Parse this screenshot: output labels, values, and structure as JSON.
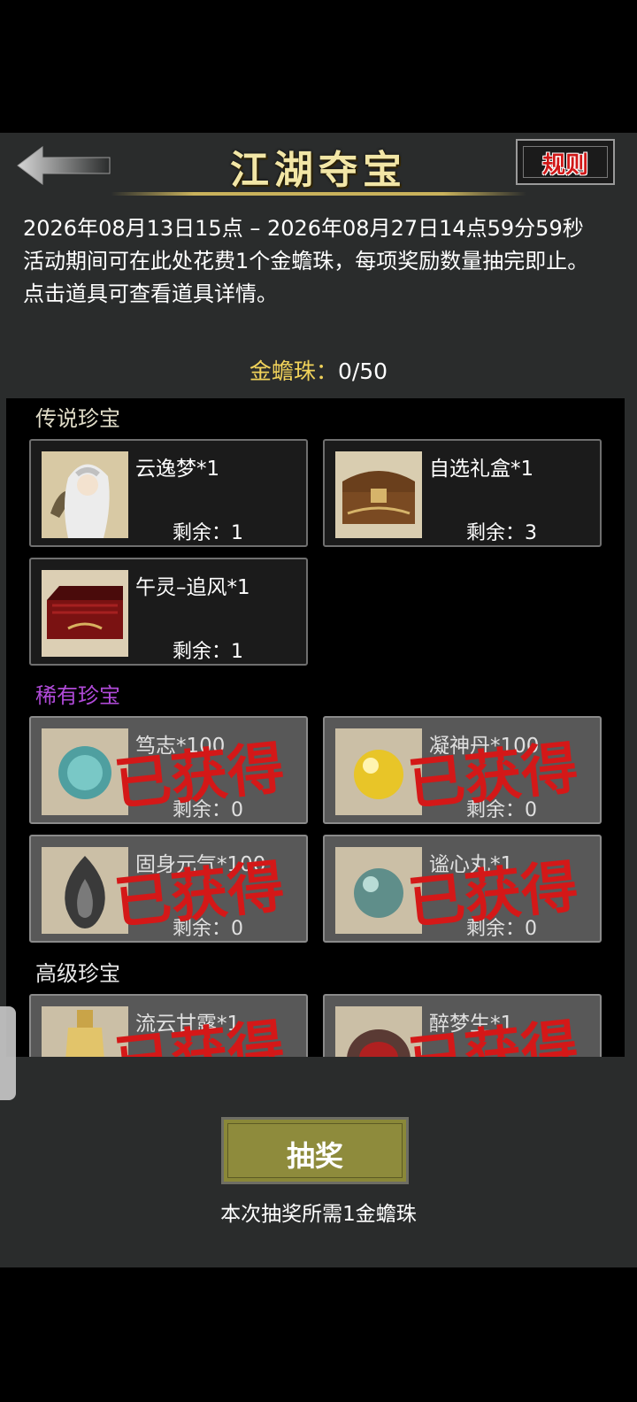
{
  "header": {
    "title": "江湖夺宝",
    "rules_label": "规则"
  },
  "info": {
    "period": "2026年08月13日15点 – 2026年08月27日14点59分59秒",
    "desc": "活动期间可在此处花费1个金蟾珠，每项奖励数量抽完即止。",
    "hint": "点击道具可查看道具详情。"
  },
  "currency": {
    "label": "金蟾珠：",
    "value": "0/50"
  },
  "sections": [
    {
      "title": "传说珍宝",
      "items": [
        {
          "name": "云逸梦*1",
          "remain": "剩余：1",
          "obtained": false,
          "icon": "portrait-woman-icon"
        },
        {
          "name": "自选礼盒*1",
          "remain": "剩余：3",
          "obtained": false,
          "icon": "treasure-chest-icon"
        },
        {
          "name": "午灵–追风*1",
          "remain": "剩余：1",
          "obtained": false,
          "icon": "red-box-icon"
        }
      ]
    },
    {
      "title": "稀有珍宝",
      "items": [
        {
          "name": "笃志*100",
          "remain": "剩余：0",
          "obtained": true,
          "icon": "blue-orb-icon"
        },
        {
          "name": "凝神丹*100",
          "remain": "剩余：0",
          "obtained": true,
          "icon": "yellow-pearl-icon"
        },
        {
          "name": "固身元气*100",
          "remain": "剩余：0",
          "obtained": true,
          "icon": "flame-icon"
        },
        {
          "name": "谧心丸*1",
          "remain": "剩余：0",
          "obtained": true,
          "icon": "teal-pearl-icon"
        }
      ]
    },
    {
      "title": "高级珍宝",
      "items": [
        {
          "name": "流云甘露*1",
          "remain": "",
          "obtained": true,
          "icon": "gourd-bottle-icon"
        },
        {
          "name": "醉梦生*1",
          "remain": "",
          "obtained": true,
          "icon": "wine-jar-icon"
        }
      ]
    }
  ],
  "obtained_stamp": "已获得",
  "draw": {
    "button_label": "抽奖",
    "note": "本次抽奖所需1金蟾珠"
  },
  "colors": {
    "panel": "#2a2c2c",
    "title_gold": "#f2e6a6",
    "currency_gold": "#f0d25a",
    "rare_purple": "#b04ad8",
    "stamp_red": "#d41818",
    "draw_button": "#8a8838"
  }
}
